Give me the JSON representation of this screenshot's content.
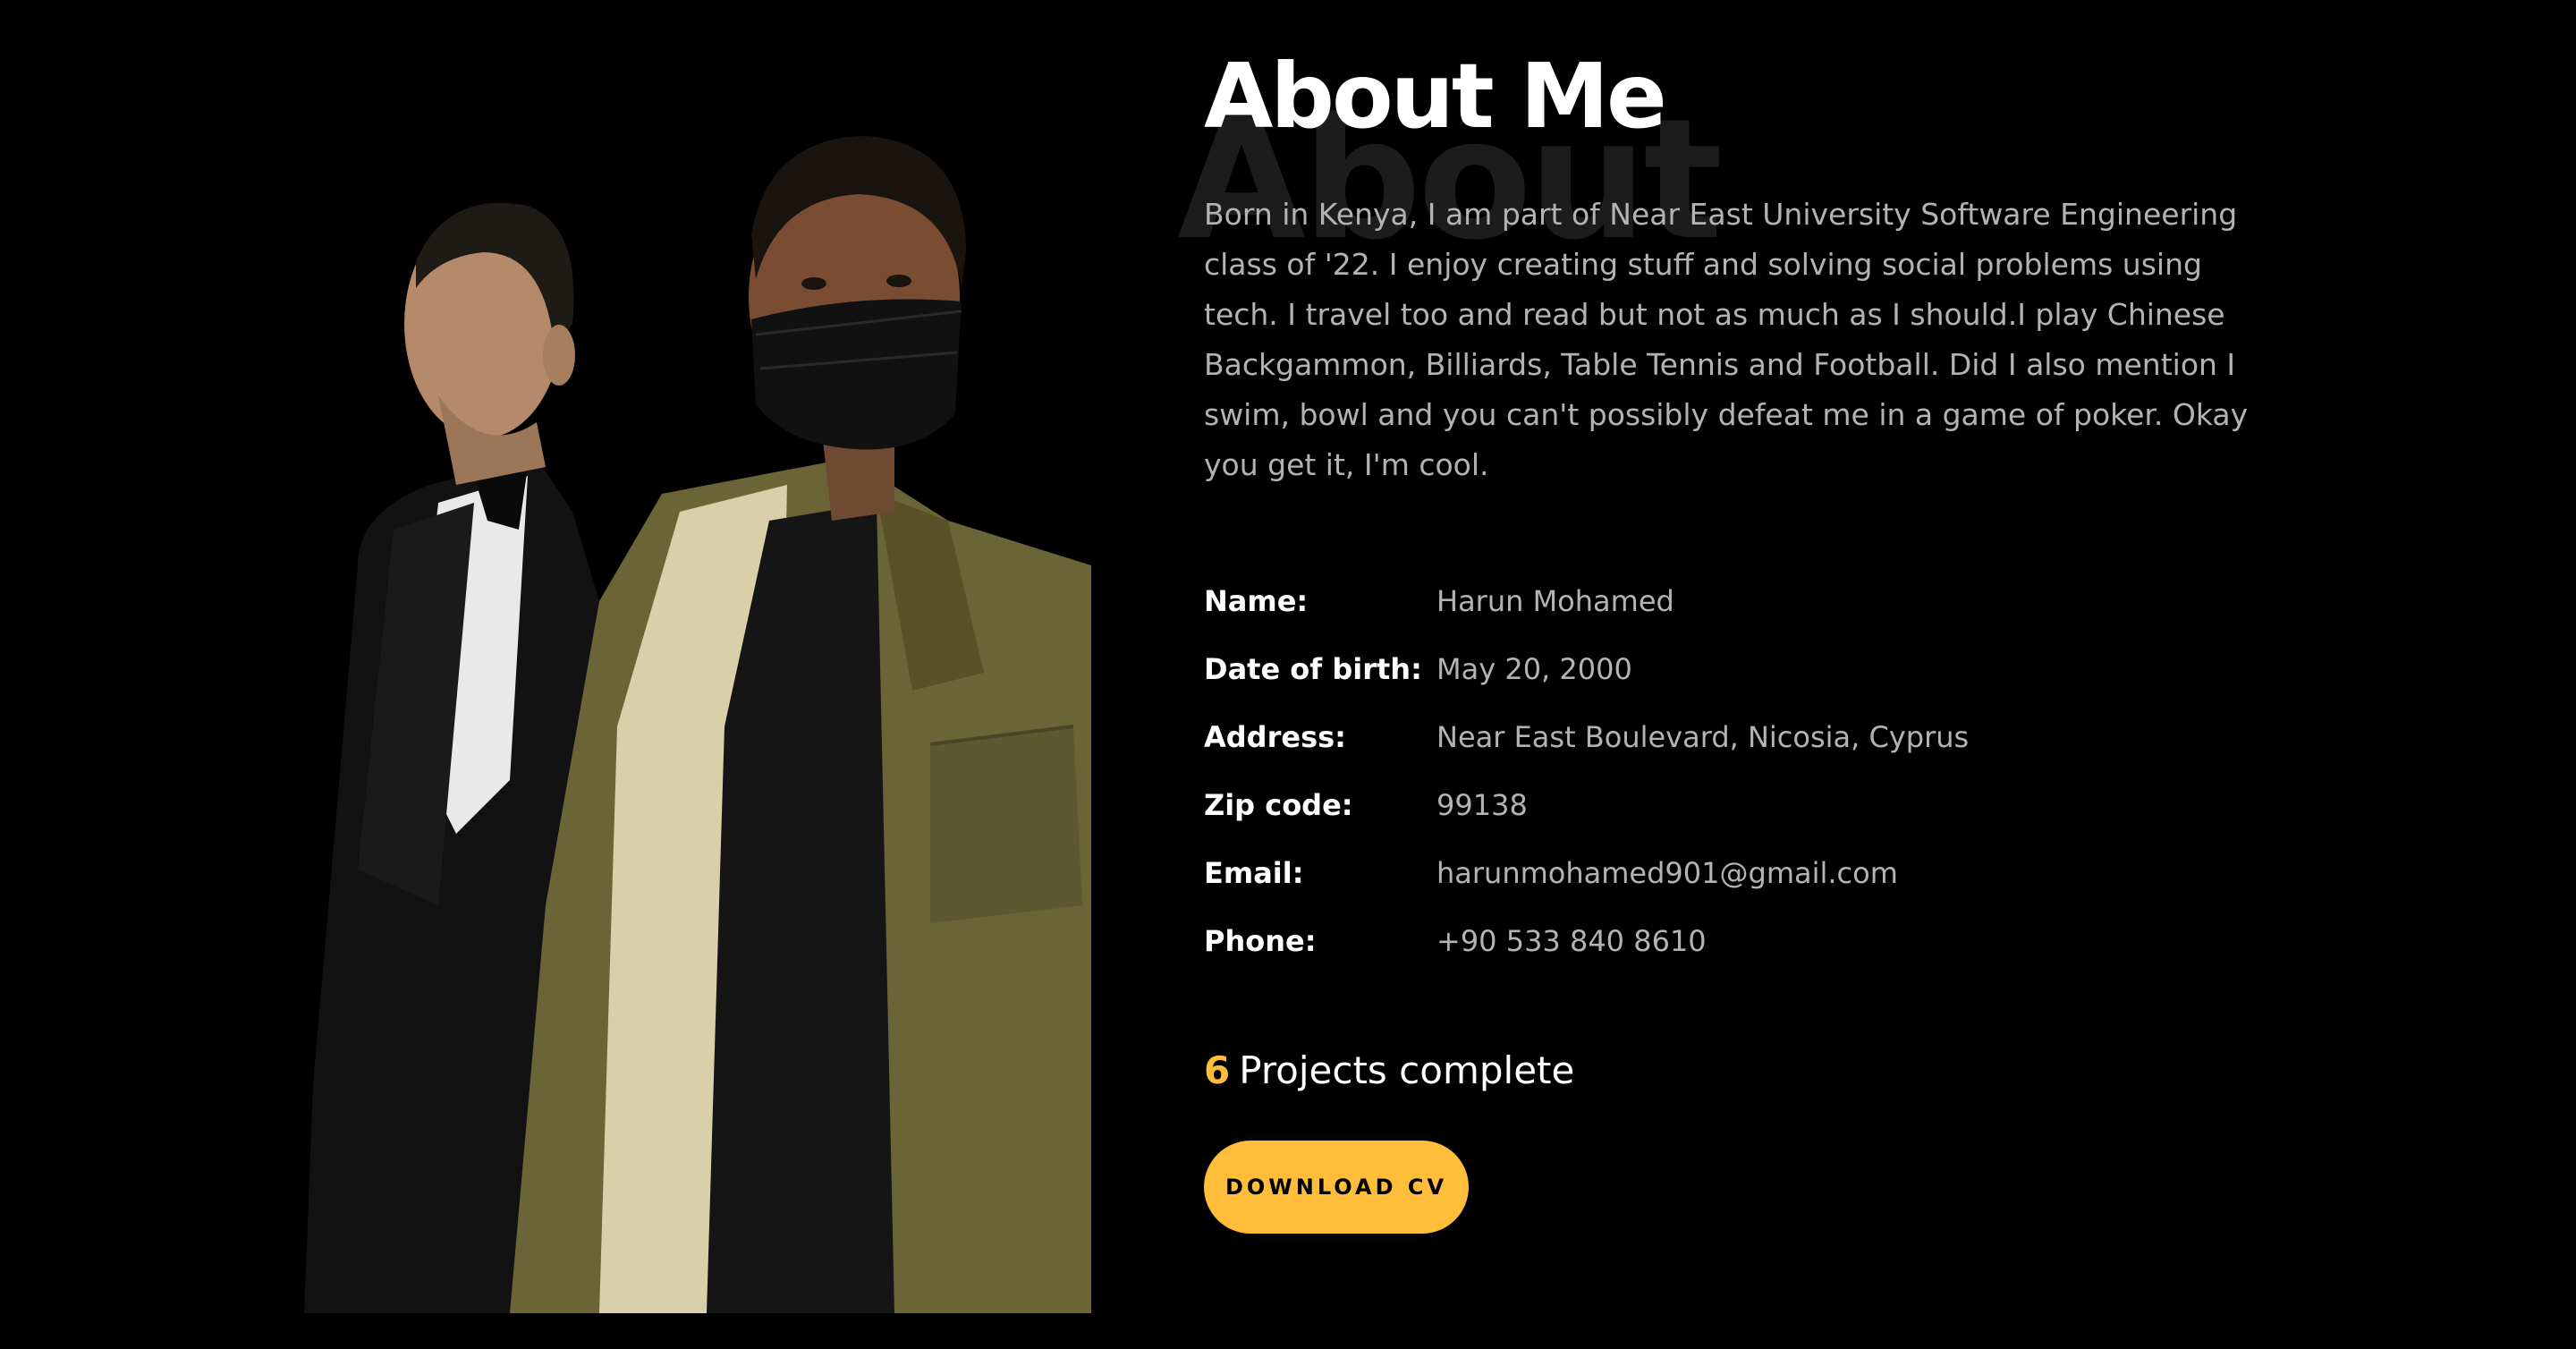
{
  "about": {
    "background_word": "About",
    "title": "About Me",
    "bio": "Born in Kenya, I am part of Near East University Software Engineering class of '22. I enjoy creating stuff and solving social problems using tech. I travel too and read but not as much as I should.I play Chinese Backgammon, Billiards, Table Tennis and Football. Did I also mention I swim, bowl and you can't possibly defeat me in a game of poker. Okay you get it, I'm cool."
  },
  "info": [
    {
      "label": "Name:",
      "value": "Harun Mohamed"
    },
    {
      "label": "Date of birth:",
      "value": "May 20, 2000"
    },
    {
      "label": "Address:",
      "value": "Near East Boulevard, Nicosia, Cyprus"
    },
    {
      "label": "Zip code:",
      "value": "99138"
    },
    {
      "label": "Email:",
      "value": "harunmohamed901@gmail.com"
    },
    {
      "label": "Phone:",
      "value": "+90 533 840 8610"
    }
  ],
  "projects": {
    "count": "6",
    "label": "Projects complete"
  },
  "cta": {
    "download_label": "DOWNLOAD CV"
  },
  "colors": {
    "accent": "#ffbd39",
    "background": "#000000",
    "muted_text": "#b3b3b3"
  }
}
